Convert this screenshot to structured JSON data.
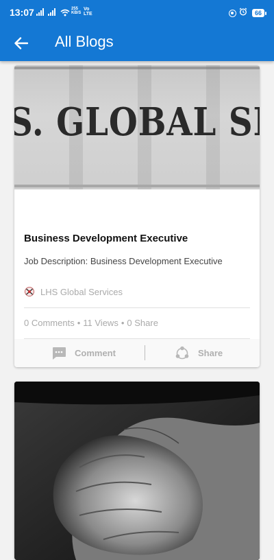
{
  "status_bar": {
    "time": "13:07",
    "net_speed_top": "255",
    "net_speed_bottom": "KB/S",
    "volte_top": "Vo",
    "volte_bottom": "LTE",
    "battery": "66"
  },
  "app_bar": {
    "title": "All Blogs",
    "color": "#1478d4"
  },
  "posts": [
    {
      "banner_text": "S. GLOBAL SERV",
      "title": "Business Development Executive",
      "description": "Job Description: Business Development Executive",
      "author": "LHS Global Services",
      "comments": "0 Comments",
      "views": "11 Views",
      "shares": "0 Share",
      "separator": "•",
      "comment_label": "Comment",
      "share_label": "Share"
    },
    {
      "image": "hands-photo"
    }
  ],
  "icons": {
    "back": "arrow-left-icon",
    "comment": "comment-icon",
    "share": "share-icon",
    "wifi": "wifi-icon",
    "alarm": "alarm-icon"
  }
}
